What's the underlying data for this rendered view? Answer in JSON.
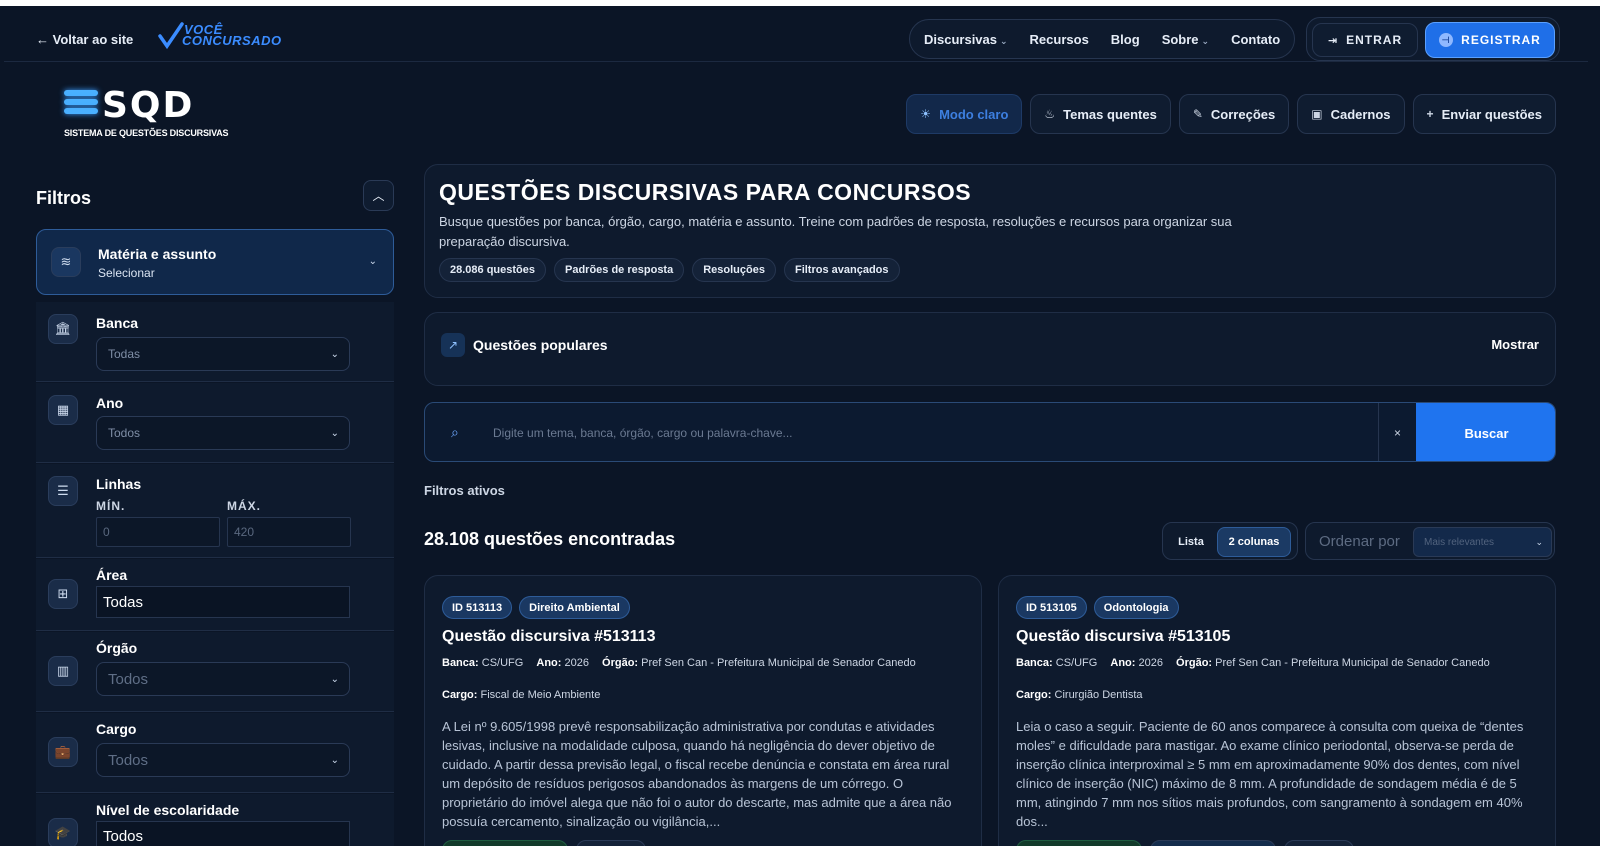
{
  "nav": {
    "back_label": "← Voltar ao site",
    "brand_line1": "VOCÊ",
    "brand_line2": "CONCURSADO",
    "menu": [
      {
        "label": "Discursivas",
        "caret": "⌄"
      },
      {
        "label": "Recursos",
        "caret": ""
      },
      {
        "label": "Blog",
        "caret": ""
      },
      {
        "label": "Sobre",
        "caret": "⌄"
      },
      {
        "label": "Contato",
        "caret": ""
      }
    ],
    "login_label": "ENTRAR",
    "register_label": "REGISTRAR"
  },
  "logo": {
    "letters": "SQD",
    "subtitle": "SISTEMA DE QUESTÕES DISCURSIVAS"
  },
  "toolbar": {
    "light_mode": "Modo claro",
    "hot_topics": "Temas quentes",
    "corrections": "Correções",
    "notebooks": "Cadernos",
    "send_questions": "Enviar questões"
  },
  "filters": {
    "title": "Filtros",
    "materia": {
      "label": "Matéria e assunto",
      "value": "Selecionar"
    },
    "banca": {
      "label": "Banca",
      "value": "Todas"
    },
    "ano": {
      "label": "Ano",
      "value": "Todos"
    },
    "linhas": {
      "label": "Linhas",
      "min_label": "MÍN.",
      "max_label": "MÁX.",
      "min_placeholder": "0",
      "max_placeholder": "420"
    },
    "area": {
      "label": "Área",
      "value": "Todas"
    },
    "orgao": {
      "label": "Órgão",
      "value": "Todos"
    },
    "cargo": {
      "label": "Cargo",
      "value": "Todos"
    },
    "nivel": {
      "label": "Nível de escolaridade",
      "value": "Todos"
    }
  },
  "hero": {
    "title": "QUESTÕES DISCURSIVAS PARA CONCURSOS",
    "description": "Busque questões por banca, órgão, cargo, matéria e assunto. Treine com padrões de resposta, resoluções e recursos para organizar sua preparação discursiva.",
    "chips": [
      "28.086 questões",
      "Padrões de resposta",
      "Resoluções",
      "Filtros avançados"
    ]
  },
  "popular": {
    "title": "Questões populares",
    "toggle": "Mostrar"
  },
  "search": {
    "placeholder": "Digite um tema, banca, órgão, cargo ou palavra-chave...",
    "clear": "×",
    "button": "Buscar"
  },
  "active_filters_label": "Filtros ativos",
  "results": {
    "count_label": "28.108 questões encontradas",
    "view_list": "Lista",
    "view_two_columns": "2 colunas",
    "sort_label": "Ordenar por",
    "sort_value": "Mais relevantes"
  },
  "questions": [
    {
      "id_tag": "ID 513113",
      "subject_tag": "Direito Ambiental",
      "title": "Questão discursiva #513113",
      "banca_label": "Banca:",
      "banca": "CS/UFG",
      "ano_label": "Ano:",
      "ano": "2026",
      "orgao_label": "Órgão:",
      "orgao": "Pref Sen Can - Prefeitura Municipal de Senador Canedo",
      "cargo_label": "Cargo:",
      "cargo": "Fiscal de Meio Ambiente",
      "text": "A Lei nº 9.605/1998 prevê responsabilização administrativa por condutas e atividades lesivas, inclusive na modalidade culposa, quando há negligência do dever objetivo de cuidado. A partir dessa previsão legal, o fiscal recebe denúncia e constata em área rural um depósito de resíduos perigosos abandonados às margens de um córrego. O proprietário do imóvel alega que não foi o autor do descarte, mas admite que a área não possuía cercamento, sinalização ou vigilância,..."
    },
    {
      "id_tag": "ID 513105",
      "subject_tag": "Odontologia",
      "title": "Questão discursiva #513105",
      "banca_label": "Banca:",
      "banca": "CS/UFG",
      "ano_label": "Ano:",
      "ano": "2026",
      "orgao_label": "Órgão:",
      "orgao": "Pref Sen Can - Prefeitura Municipal de Senador Canedo",
      "cargo_label": "Cargo:",
      "cargo": "Cirurgião Dentista",
      "text": "Leia o caso a seguir. Paciente de 60 anos comparece à consulta com queixa de “dentes moles” e dificuldade para mastigar. Ao exame clínico periodontal, observa-se perda de inserção clínica interproximal ≥ 5 mm em aproximadamente 90% dos dentes, com nível clínico de inserção (NIC) máximo de 8 mm. A profundidade de sondagem média é de 5 mm, atingindo 7 mm nos sítios mais profundos, com sangramento à sondagem em 40% dos..."
    }
  ]
}
